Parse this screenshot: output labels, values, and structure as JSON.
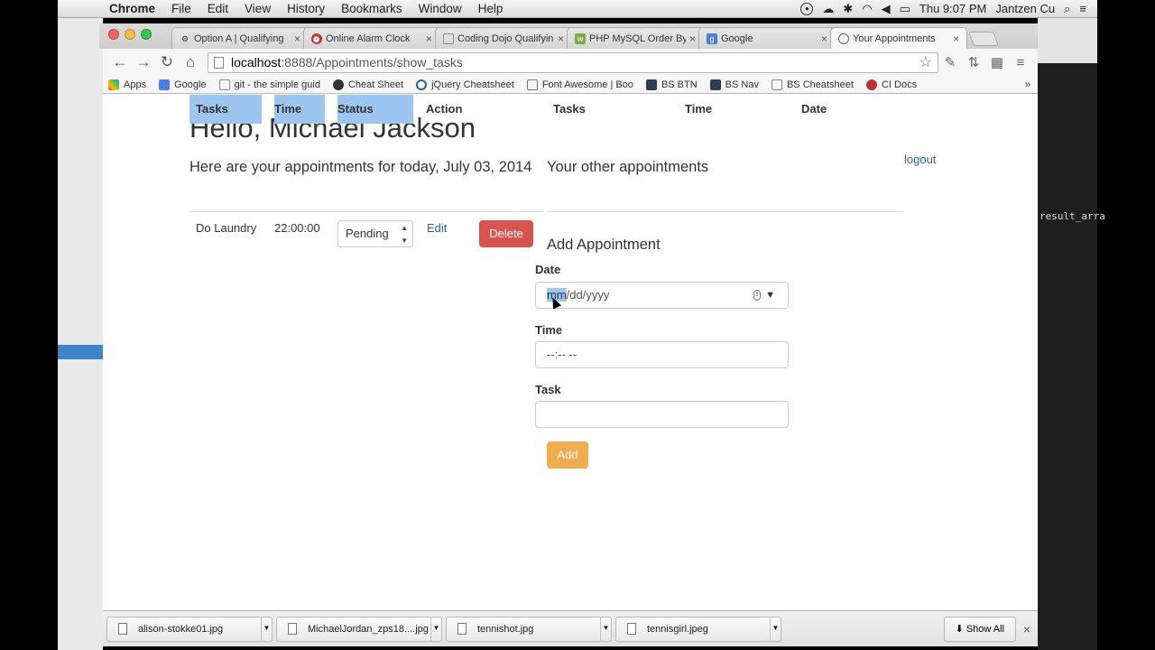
{
  "menubar": {
    "app": "Chrome",
    "items": [
      "File",
      "Edit",
      "View",
      "History",
      "Bookmarks",
      "Window",
      "Help"
    ],
    "clock": "Thu 9:07 PM",
    "user": "Jantzen Cu"
  },
  "tabs": [
    {
      "title": "Option A | Qualifying",
      "active": false
    },
    {
      "title": "Online Alarm Clock",
      "active": false
    },
    {
      "title": "Coding Dojo Qualifyin",
      "active": false
    },
    {
      "title": "PHP MySQL Order By K",
      "active": false
    },
    {
      "title": "Google",
      "active": false
    },
    {
      "title": "Your Appointments",
      "active": true
    }
  ],
  "address": {
    "host": "localhost",
    "path": ":8888/Appointments/show_tasks"
  },
  "bookmarks": [
    "Apps",
    "Google",
    "git - the simple guid",
    "Cheat Sheet",
    "jQuery Cheatsheet",
    "Font Awesome | Boo",
    "BS BTN",
    "BS Nav",
    "BS Cheatsheet",
    "CI Docs"
  ],
  "page": {
    "greeting": "Hello, Michael Jackson",
    "logout": "logout",
    "today_heading": "Here are your appointments for today, July 03, 2014",
    "other_heading": "Your other appointments",
    "today_columns": [
      "Tasks",
      "Time",
      "Status",
      "Action"
    ],
    "other_columns": [
      "Tasks",
      "Time",
      "Date"
    ],
    "rows": [
      {
        "task": "Do Laundry",
        "time": "22:00:00",
        "status": "Pending",
        "edit": "Edit",
        "delete": "Delete"
      }
    ],
    "form": {
      "heading": "Add Appointment",
      "date_label": "Date",
      "date_value_highlight": "mm",
      "date_value_rest": "/dd/yyyy",
      "time_label": "Time",
      "time_value": "--:-- --",
      "task_label": "Task",
      "task_value": "",
      "submit": "Add"
    }
  },
  "downloads": [
    "alison-stokke01.jpg",
    "MichaelJordan_zps18....jpg",
    "tennishot.jpg",
    "tennisgirl.jpeg"
  ],
  "show_all": "Show All",
  "backdrop": {
    "code_snippet": "result_arra"
  },
  "colors": {
    "delete": "#d9534f",
    "add": "#f0ad4e",
    "link": "#2a6496",
    "selection": "#9cc6ef"
  }
}
